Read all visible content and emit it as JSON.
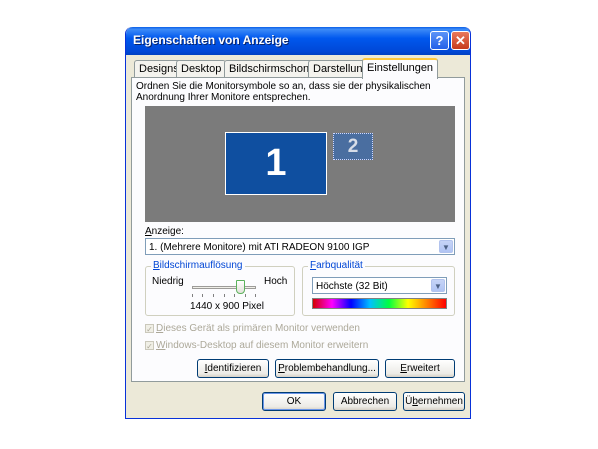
{
  "window": {
    "title": "Eigenschaften von Anzeige"
  },
  "tabs": [
    "Designs",
    "Desktop",
    "Bildschirmschoner",
    "Darstellung",
    "Einstellungen"
  ],
  "description": "Ordnen Sie die Monitorsymbole so an, dass sie der physikalischen Anordnung Ihrer Monitore entsprechen.",
  "monitors": {
    "primary": "1",
    "secondary": "2"
  },
  "display": {
    "label_mnemonic": "A",
    "label_rest": "nzeige:",
    "selected": "1. (Mehrere Monitore) mit ATI RADEON 9100 IGP"
  },
  "resolution": {
    "group_mnemonic": "B",
    "group_rest": "ildschirmauflösung",
    "low": "Niedrig",
    "high": "Hoch",
    "value_text": "1440 x 900 Pixel",
    "slider_position": 0.75
  },
  "color": {
    "group_mnemonic": "F",
    "group_rest": "arbqualität",
    "selected": "Höchste (32 Bit)"
  },
  "checkboxes": {
    "primary_mnemonic": "D",
    "primary_rest": "ieses Gerät als primären Monitor verwenden",
    "extend_mnemonic": "W",
    "extend_rest": "indows-Desktop auf diesem Monitor erweitern"
  },
  "panel_buttons": {
    "identify_mnemonic": "I",
    "identify_rest": "dentifizieren",
    "troubleshoot_mnemonic": "P",
    "troubleshoot_rest": "roblembehandlung...",
    "advanced_mnemonic": "E",
    "advanced_rest": "rweitert"
  },
  "dialog_buttons": {
    "ok": "OK",
    "cancel": "Abbrechen",
    "apply_pre": "Ü",
    "apply_mnemonic": "b",
    "apply_rest": "ernehmen"
  }
}
